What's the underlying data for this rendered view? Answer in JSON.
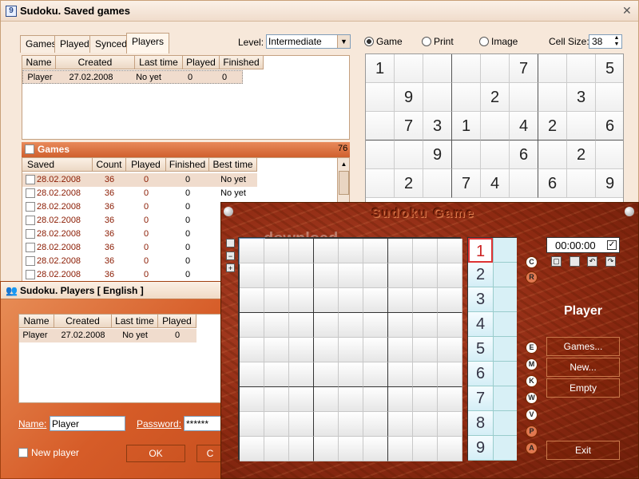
{
  "main_window": {
    "title": "Sudoku. Saved games",
    "icon_glyph": "9",
    "tabs": [
      "Games",
      "Played",
      "Synced",
      "Players"
    ],
    "level_label": "Level:",
    "level_value": "Intermediate",
    "mode_options": [
      "Game",
      "Print",
      "Image"
    ],
    "cell_size_label": "Cell Size:",
    "cell_size_value": "38",
    "players_table": {
      "headers": [
        "Name",
        "Created",
        "Last time",
        "Played",
        "Finished"
      ],
      "rows": [
        [
          "Player",
          "27.02.2008",
          "No yet",
          "0",
          "0"
        ]
      ]
    },
    "games_section": {
      "label": "Games",
      "count": "76",
      "headers": [
        "Saved",
        "Count",
        "Played",
        "Finished",
        "Best time"
      ],
      "rows": [
        [
          "28.02.2008",
          "36",
          "0",
          "0",
          "No yet"
        ],
        [
          "28.02.2008",
          "36",
          "0",
          "0",
          "No yet"
        ],
        [
          "28.02.2008",
          "36",
          "0",
          "0",
          ""
        ],
        [
          "28.02.2008",
          "36",
          "0",
          "0",
          ""
        ],
        [
          "28.02.2008",
          "36",
          "0",
          "0",
          ""
        ],
        [
          "28.02.2008",
          "36",
          "0",
          "0",
          ""
        ],
        [
          "28.02.2008",
          "36",
          "0",
          "0",
          ""
        ],
        [
          "28.02.2008",
          "36",
          "0",
          "0",
          ""
        ]
      ]
    },
    "preview_grid": [
      [
        "1",
        "",
        "",
        "",
        "",
        "7",
        "",
        "",
        "5"
      ],
      [
        "",
        "9",
        "",
        "",
        "2",
        "",
        "",
        "3",
        ""
      ],
      [
        "",
        "7",
        "3",
        "1",
        "",
        "4",
        "2",
        "",
        "6"
      ],
      [
        "",
        "",
        "9",
        "",
        "",
        "6",
        "",
        "2",
        ""
      ],
      [
        "",
        "2",
        "",
        "7",
        "4",
        "",
        "6",
        "",
        "9"
      ]
    ]
  },
  "players_window": {
    "title": "Sudoku. Players [ English ]",
    "headers": [
      "Name",
      "Created",
      "Last time",
      "Played"
    ],
    "rows": [
      [
        "Player",
        "27.02.2008",
        "No yet",
        "0"
      ]
    ],
    "name_label": "Name:",
    "name_value": "Player",
    "password_label": "Password:",
    "password_value": "******",
    "new_player_label": "New player",
    "ok_label": "OK",
    "cancel_label": "C"
  },
  "game_window": {
    "title": "Sudoku Game",
    "watermark": "download",
    "timer": "00:00:00",
    "numbers": [
      "1",
      "2",
      "3",
      "4",
      "5",
      "6",
      "7",
      "8",
      "9"
    ],
    "side_letters_top": [
      "C",
      "R"
    ],
    "level_letters": [
      "E",
      "M",
      "K",
      "W",
      "V",
      "P",
      "A"
    ],
    "player_name": "Player",
    "games_btn": "Games...",
    "new_btn": "New...",
    "empty_btn": "Empty",
    "exit_btn": "Exit"
  }
}
